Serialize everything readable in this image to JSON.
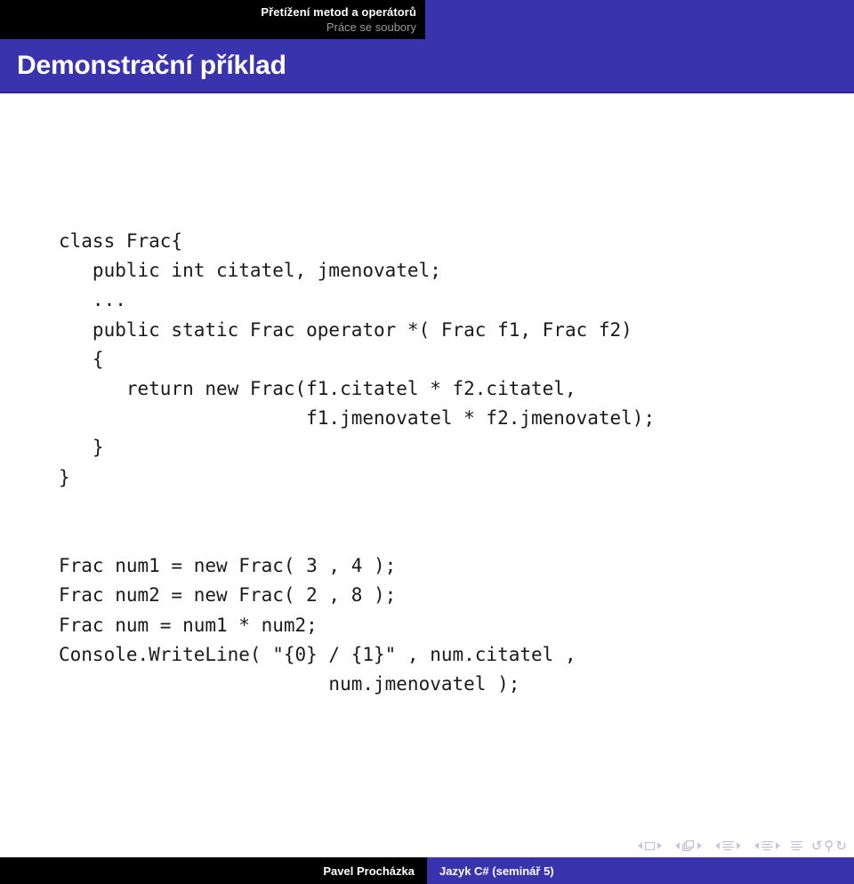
{
  "header": {
    "section_title": "Přetížení metod a operátorů",
    "subsection_title": "Práce se soubory",
    "bar_color": "#3a33ae",
    "black_color": "#000000"
  },
  "slide": {
    "frame_title": "Demonstrační příklad",
    "code": "class Frac{\n   public int citatel, jmenovatel;\n   ...\n   public static Frac operator *( Frac f1, Frac f2)\n   {\n      return new Frac(f1.citatel * f2.citatel,\n                      f1.jmenovatel * f2.jmenovatel);\n   }\n}\n\n\nFrac num1 = new Frac( 3 , 4 );\nFrac num2 = new Frac( 2 , 8 );\nFrac num = num1 * num2;\nConsole.WriteLine( \"{0} / {1}\" , num.citatel ,\n                        num.jmenovatel );"
  },
  "navigation": {
    "items": [
      {
        "name": "slide",
        "glyph": "slide-icon"
      },
      {
        "name": "frame",
        "glyph": "frame-icon"
      },
      {
        "name": "subsection",
        "glyph": "subsection-icon"
      },
      {
        "name": "section",
        "glyph": "section-icon"
      },
      {
        "name": "document",
        "glyph": "document-icon"
      }
    ],
    "back": "↺",
    "search": "⚲",
    "forward": "↻"
  },
  "footer": {
    "author": "Pavel Procházka",
    "title": "Jazyk C# (seminář 5)"
  }
}
